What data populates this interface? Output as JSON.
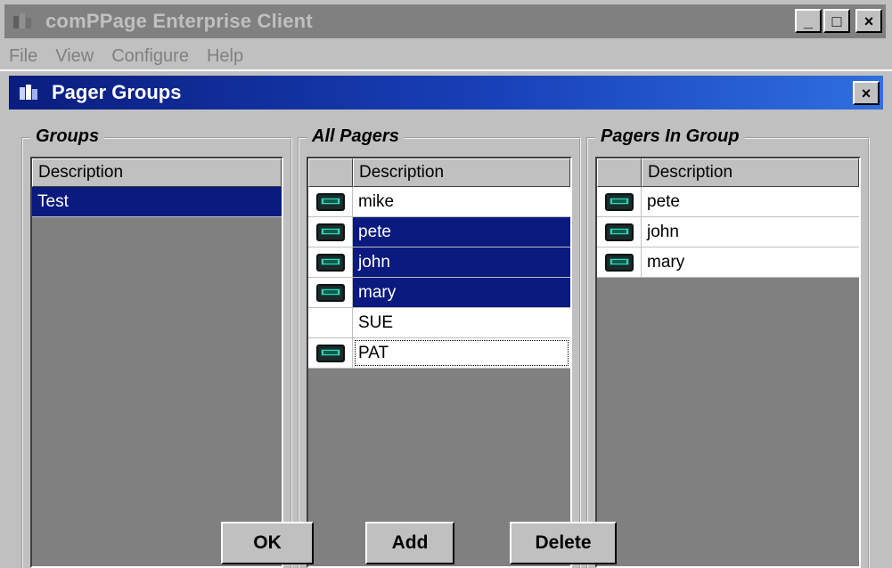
{
  "app": {
    "title": "comPPage Enterprise Client",
    "minimize": "_",
    "maximize": "□",
    "close": "×",
    "menu": [
      "File",
      "View",
      "Configure",
      "Help"
    ]
  },
  "dialog": {
    "title": "Pager Groups",
    "close": "×"
  },
  "groups": {
    "legend": "Groups",
    "header": "Description",
    "rows": [
      {
        "desc": "Test",
        "selected": true
      }
    ]
  },
  "all_pagers": {
    "legend": "All Pagers",
    "header": "Description",
    "rows": [
      {
        "desc": "mike",
        "icon": "pager-icon",
        "selected": false
      },
      {
        "desc": "pete",
        "icon": "pager-icon",
        "selected": true
      },
      {
        "desc": "john",
        "icon": "pager-icon",
        "selected": true
      },
      {
        "desc": "mary",
        "icon": "pager-icon",
        "selected": true
      },
      {
        "desc": "SUE",
        "icon": "",
        "selected": false
      },
      {
        "desc": "PAT",
        "icon": "pager-icon",
        "selected": false,
        "focused": true
      }
    ]
  },
  "pagers_in_group": {
    "legend": "Pagers In Group",
    "header": "Description",
    "rows": [
      {
        "desc": "pete",
        "icon": "pager-icon"
      },
      {
        "desc": "john",
        "icon": "pager-icon"
      },
      {
        "desc": "mary",
        "icon": "pager-icon"
      }
    ]
  },
  "buttons": {
    "ok": "OK",
    "add": "Add",
    "delete": "Delete"
  },
  "colors": {
    "selection": "#0a1a7e",
    "dialog_title_gradient_start": "#0a1d7e",
    "dialog_title_gradient_end": "#2f6fe0",
    "face": "#c0c0c0"
  }
}
